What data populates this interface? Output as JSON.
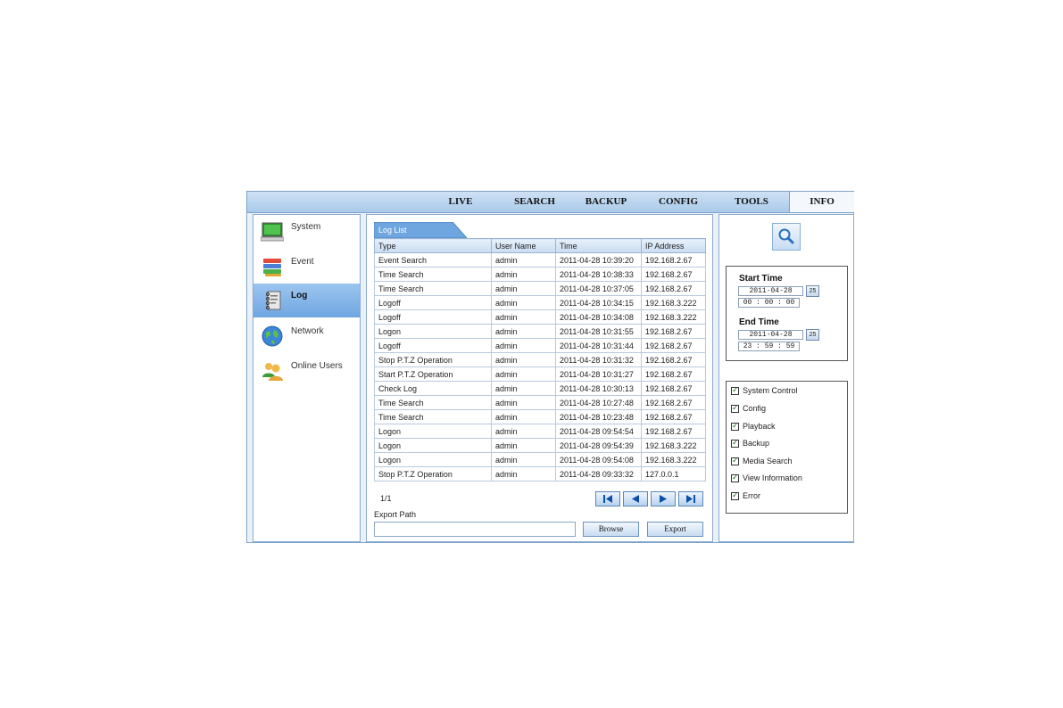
{
  "nav": {
    "tabs": [
      {
        "label": "LIVE"
      },
      {
        "label": "SEARCH"
      },
      {
        "label": "BACKUP"
      },
      {
        "label": "CONFIG"
      },
      {
        "label": "TOOLS"
      },
      {
        "label": "INFO",
        "active": true
      }
    ]
  },
  "sidebar": {
    "items": [
      {
        "label": "System",
        "icon": "monitor-icon"
      },
      {
        "label": "Event",
        "icon": "stack-icon"
      },
      {
        "label": "Log",
        "icon": "notebook-icon",
        "active": true
      },
      {
        "label": "Network",
        "icon": "globe-icon"
      },
      {
        "label": "Online Users",
        "icon": "users-icon"
      }
    ]
  },
  "log": {
    "tab_label": "Log List",
    "columns": [
      "Type",
      "User Name",
      "Time",
      "IP Address"
    ],
    "rows": [
      [
        "Event Search",
        "admin",
        "2011-04-28 10:39:20",
        "192.168.2.67"
      ],
      [
        "Time Search",
        "admin",
        "2011-04-28 10:38:33",
        "192.168.2.67"
      ],
      [
        "Time Search",
        "admin",
        "2011-04-28 10:37:05",
        "192.168.2.67"
      ],
      [
        "Logoff",
        "admin",
        "2011-04-28 10:34:15",
        "192.168.3.222"
      ],
      [
        "Logoff",
        "admin",
        "2011-04-28 10:34:08",
        "192.168.3.222"
      ],
      [
        "Logon",
        "admin",
        "2011-04-28 10:31:55",
        "192.168.2.67"
      ],
      [
        "Logoff",
        "admin",
        "2011-04-28 10:31:44",
        "192.168.2.67"
      ],
      [
        "Stop P.T.Z Operation",
        "admin",
        "2011-04-28 10:31:32",
        "192.168.2.67"
      ],
      [
        "Start P.T.Z Operation",
        "admin",
        "2011-04-28 10:31:27",
        "192.168.2.67"
      ],
      [
        "Check Log",
        "admin",
        "2011-04-28 10:30:13",
        "192.168.2.67"
      ],
      [
        "Time Search",
        "admin",
        "2011-04-28 10:27:48",
        "192.168.2.67"
      ],
      [
        "Time Search",
        "admin",
        "2011-04-28 10:23:48",
        "192.168.2.67"
      ],
      [
        "Logon",
        "admin",
        "2011-04-28 09:54:54",
        "192.168.2.67"
      ],
      [
        "Logon",
        "admin",
        "2011-04-28 09:54:39",
        "192.168.3.222"
      ],
      [
        "Logon",
        "admin",
        "2011-04-28 09:54:08",
        "192.168.3.222"
      ],
      [
        "Stop P.T.Z Operation",
        "admin",
        "2011-04-28 09:33:32",
        "127.0.0.1"
      ]
    ],
    "page_info": "1/1",
    "export_label": "Export Path",
    "export_path": "",
    "browse_label": "Browse",
    "export_button_label": "Export"
  },
  "filter": {
    "start_label": "Start Time",
    "start_date": "2011-04-28",
    "start_time": "00 : 00 : 00",
    "end_label": "End Time",
    "end_date": "2011-04-28",
    "end_time": "23 : 59 : 59",
    "calendar_label": "25",
    "categories": [
      {
        "label": "System Control",
        "checked": true
      },
      {
        "label": "Config",
        "checked": true
      },
      {
        "label": "Playback",
        "checked": true
      },
      {
        "label": "Backup",
        "checked": true
      },
      {
        "label": "Media Search",
        "checked": true
      },
      {
        "label": "View Information",
        "checked": true
      },
      {
        "label": "Error",
        "checked": true
      }
    ]
  },
  "colors": {
    "accent": "#6fa6e0",
    "frame": "#7fa3c8",
    "panel_bg": "#eaf1fa"
  }
}
